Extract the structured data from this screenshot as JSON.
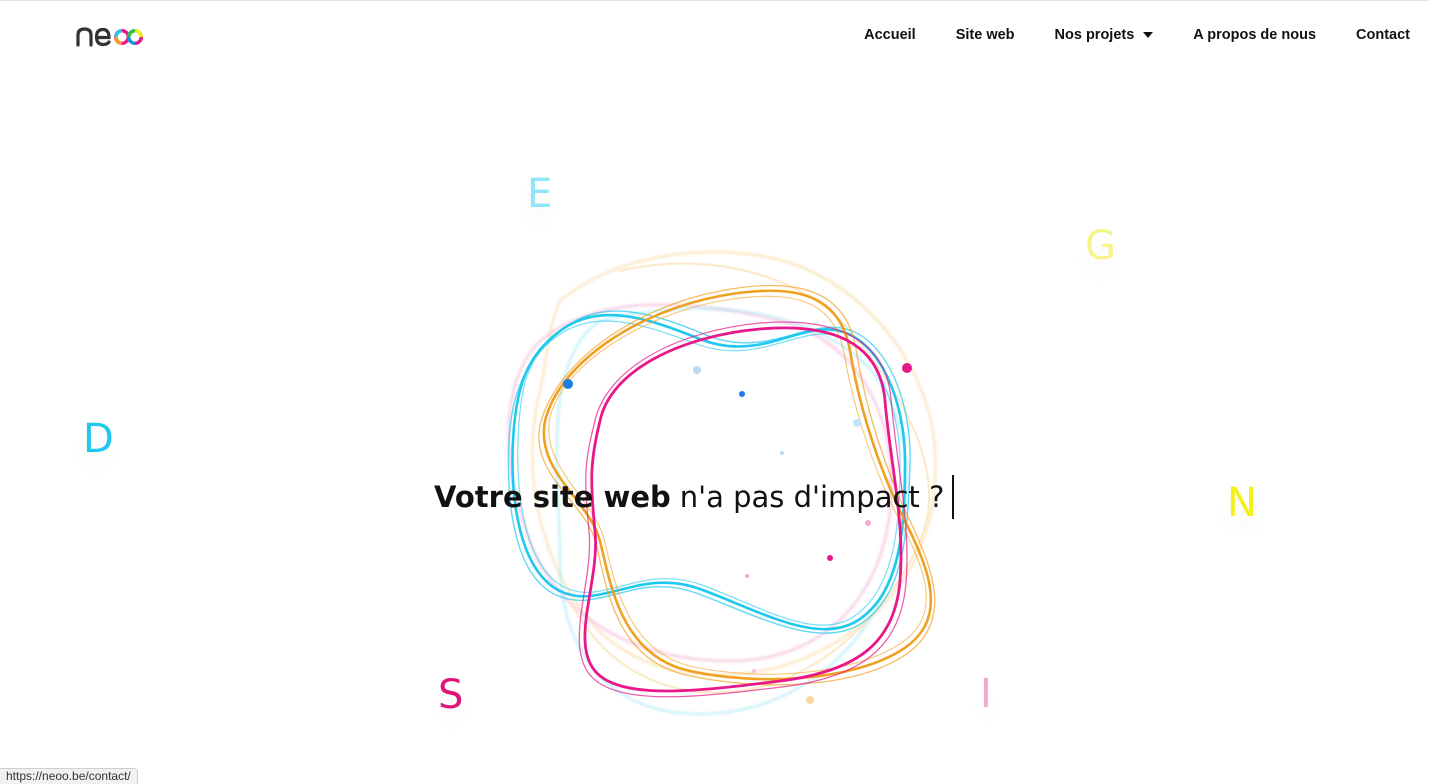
{
  "header": {
    "logo_text": "neoo",
    "nav": [
      {
        "label": "Accueil"
      },
      {
        "label": "Site web"
      },
      {
        "label": "Nos projets",
        "has_dropdown": true
      },
      {
        "label": "A propos de nous"
      },
      {
        "label": "Contact"
      }
    ]
  },
  "hero": {
    "letters": [
      {
        "char": "D",
        "color": "#1ec8ee"
      },
      {
        "char": "E",
        "color": "#8ee6f7"
      },
      {
        "char": "S",
        "color": "#e0157a"
      },
      {
        "char": "I",
        "color": "#f3a8cf"
      },
      {
        "char": "G",
        "color": "#f5f58a"
      },
      {
        "char": "N",
        "color": "#f4ef14"
      }
    ],
    "headline_bold": "Votre site web",
    "headline_light": "n'a pas d'impact ?",
    "ring_colors": {
      "cyan": "#1ec8ee",
      "orange": "#f0a020",
      "magenta": "#e8188a",
      "pale_cyan": "#a8eaf7",
      "pale_orange": "#f9d9a0",
      "pale_pink": "#f7c0dd"
    }
  },
  "status_bar": {
    "url": "https://neoo.be/contact/"
  }
}
